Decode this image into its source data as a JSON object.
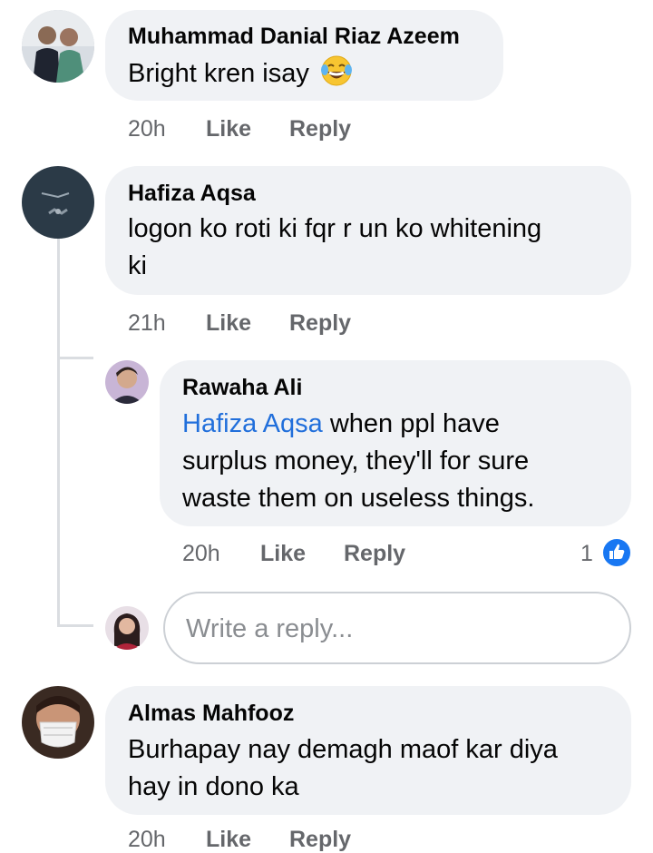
{
  "comments": [
    {
      "name": "Muhammad Danial Riaz Azeem",
      "text": "Bright kren isay",
      "emoji": "laughing-tears-emoji",
      "time": "20h",
      "like": "Like",
      "reply": "Reply"
    },
    {
      "name": "Hafiza Aqsa",
      "text_line1": "logon ko roti ki fqr r un ko whitening",
      "text_line2": "ki",
      "time": "21h",
      "like": "Like",
      "reply": "Reply",
      "replies": [
        {
          "name": "Rawaha Ali",
          "mention": "Hafiza Aqsa",
          "text_line1": " when ppl have",
          "text_line2": "surplus money, they'll for sure",
          "text_line3": "waste them on useless things.",
          "time": "20h",
          "like": "Like",
          "reply": "Reply",
          "reaction_count": "1",
          "reaction_icon": "thumbs-up-icon"
        }
      ],
      "reply_box_placeholder": "Write a reply..."
    },
    {
      "name": "Almas Mahfooz",
      "text_line1": "Burhapay nay demagh maof kar diya",
      "text_line2": "hay in dono ka",
      "time": "20h",
      "like": "Like",
      "reply": "Reply"
    }
  ],
  "colors": {
    "bubble": "#f0f2f5",
    "meta": "#65676b",
    "mention": "#216fdb",
    "like_blue": "#1877f2"
  }
}
